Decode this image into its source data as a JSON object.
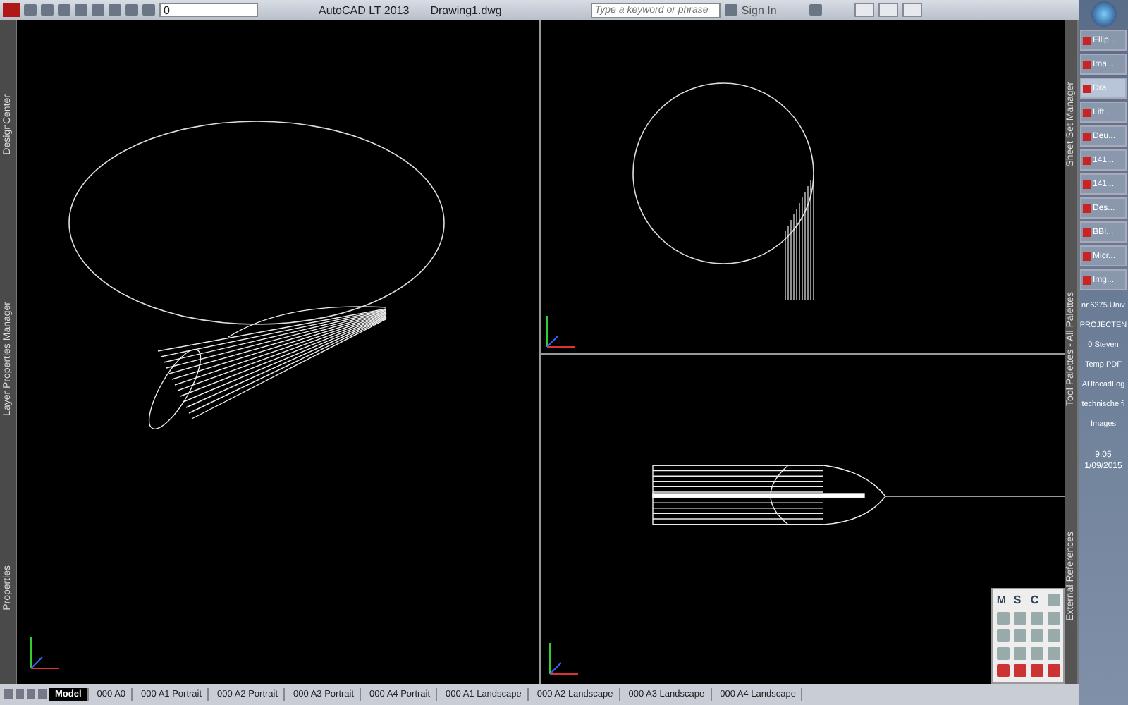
{
  "title_bar": {
    "layer": "0",
    "app_title": "AutoCAD LT 2013",
    "file_name": "Drawing1.dwg",
    "search": {
      "placeholder": "Type a keyword or phrase"
    },
    "sign_in": "Sign In"
  },
  "left_palettes": [
    "DesignCenter",
    "Layer Properties Manager",
    "Properties"
  ],
  "right_palettes": [
    "Sheet Set Manager",
    "Tool Palettes - All Palettes",
    "External References"
  ],
  "floating_toolbar": {
    "letters": [
      "M",
      "S",
      "C"
    ]
  },
  "layout_tabs": [
    {
      "label": "Model",
      "selected": true
    },
    {
      "label": "000 A0",
      "selected": false
    },
    {
      "label": "000 A1 Portrait",
      "selected": false
    },
    {
      "label": "000 A2 Portrait",
      "selected": false
    },
    {
      "label": "000 A3 Portrait",
      "selected": false
    },
    {
      "label": "000 A4 Portrait",
      "selected": false
    },
    {
      "label": "000 A1 Landscape",
      "selected": false
    },
    {
      "label": "000 A2 Landscape",
      "selected": false
    },
    {
      "label": "000 A3 Landscape",
      "selected": false
    },
    {
      "label": "000 A4 Landscape",
      "selected": false
    }
  ],
  "taskbar": {
    "windows": [
      {
        "label": "Ellip...",
        "selected": false
      },
      {
        "label": "Ima...",
        "selected": false
      },
      {
        "label": "Dra...",
        "selected": true
      },
      {
        "label": "Lift ...",
        "selected": false
      },
      {
        "label": "Deu...",
        "selected": false
      },
      {
        "label": "141...",
        "selected": false
      },
      {
        "label": "141...",
        "selected": false
      },
      {
        "label": "Des...",
        "selected": false
      },
      {
        "label": "BBI...",
        "selected": false
      },
      {
        "label": "Micr...",
        "selected": false
      },
      {
        "label": "Img...",
        "selected": false
      }
    ],
    "folders": [
      "nr.6375 Univ",
      "PROJECTEN",
      "0 Steven",
      "Temp PDF",
      "AUtocadLog",
      "technische fi",
      "Images"
    ],
    "time": "9:05",
    "date": "1/09/2015"
  }
}
